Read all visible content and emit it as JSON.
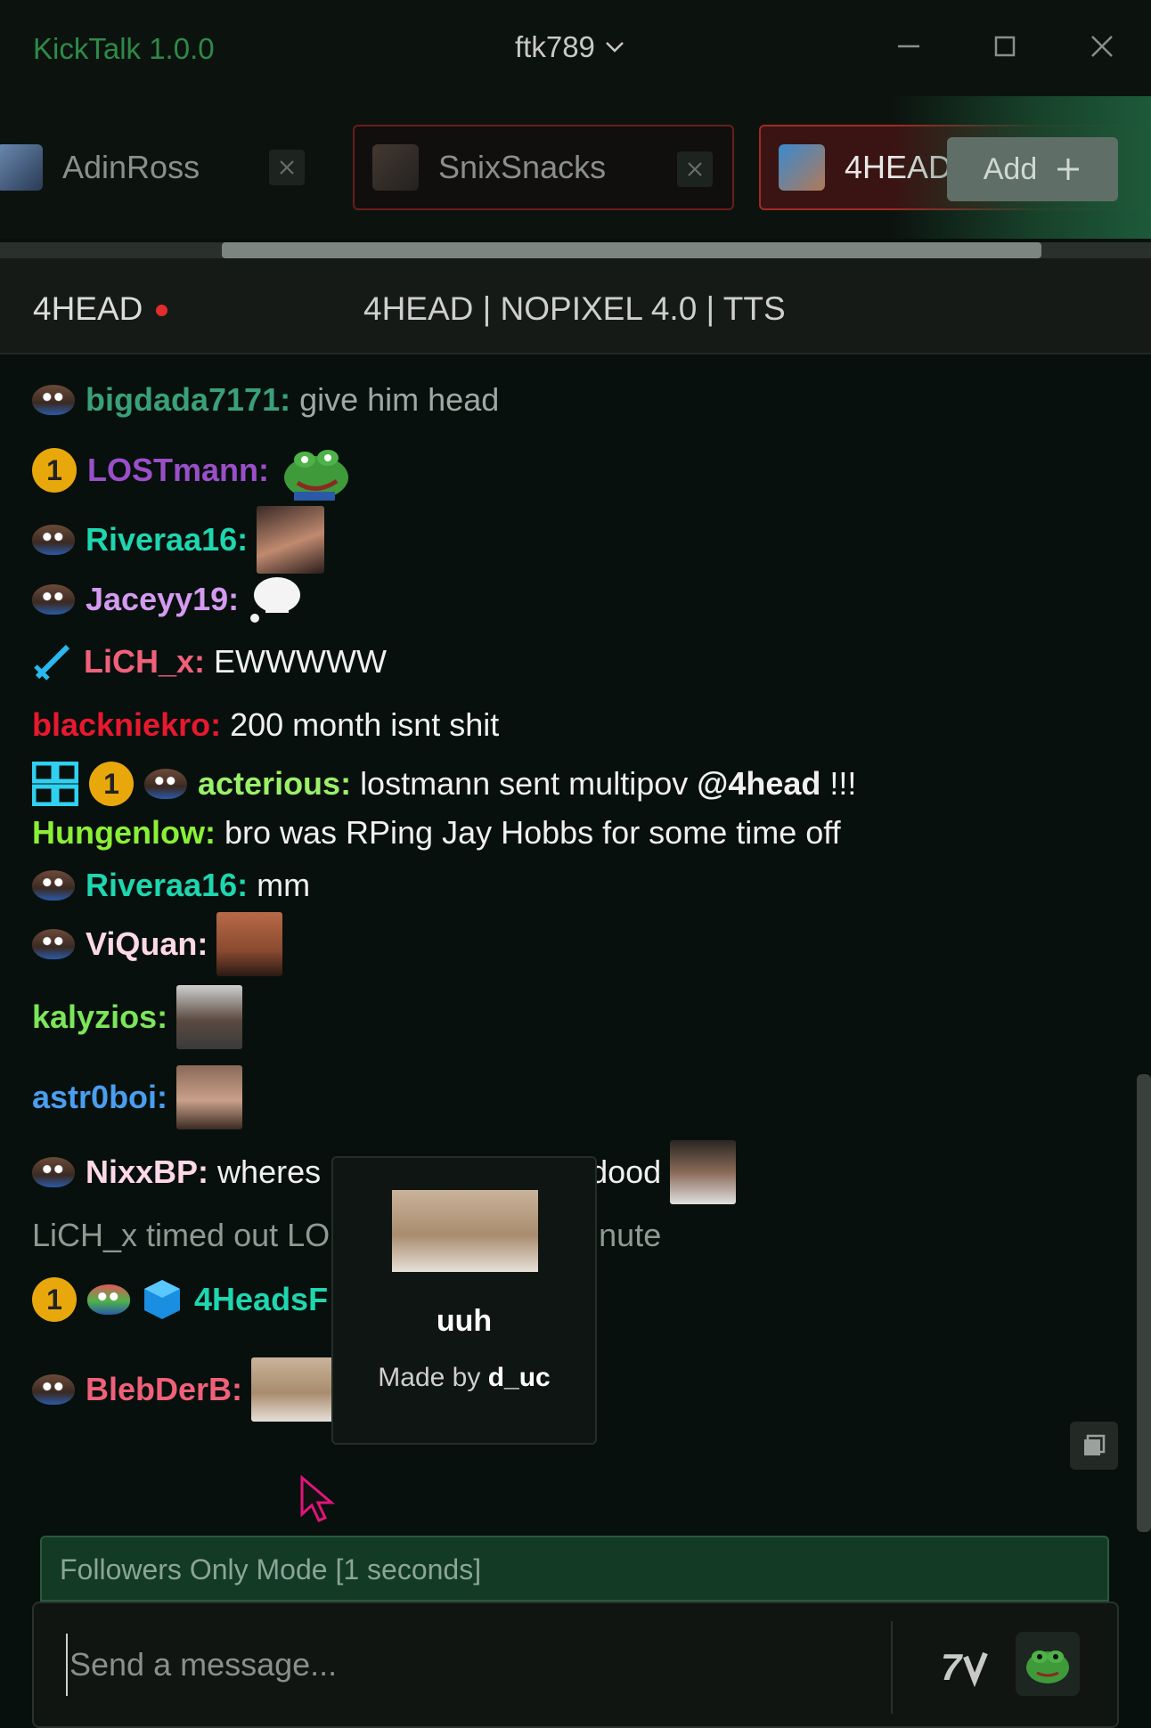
{
  "window": {
    "app_title": "KickTalk 1.0.0",
    "account": "ftk789"
  },
  "tabs": [
    {
      "name": "AdinRoss"
    },
    {
      "name": "SnixSnacks"
    },
    {
      "name": "4HEAD"
    }
  ],
  "add_button_label": "Add",
  "channel": {
    "name": "4HEAD",
    "stream_title": "4HEAD | NOPIXEL 4.0 | TTS"
  },
  "messages": [
    {
      "user": "bigdada7171:",
      "text": "give him head",
      "user_color": "#3aa07a",
      "text_color": "#a0a8a3"
    },
    {
      "user": "LOSTmann:",
      "text": "",
      "user_color": "#9a4fc9"
    },
    {
      "user": "Riveraa16:",
      "text": "",
      "user_color": "#1ed6b0"
    },
    {
      "user": "Jaceyy19:",
      "text": "",
      "user_color": "#d49af0"
    },
    {
      "user": "LiCH_x:",
      "text": "EWWWWW",
      "user_color": "#f0607a"
    },
    {
      "user": "blackniekro:",
      "text": "200 month isnt shit",
      "user_color": "#e8182e"
    },
    {
      "user": "acterious:",
      "text": "lostmann sent multipov",
      "mention": "@4head",
      "suffix": "!!!",
      "user_color": "#9bf06a"
    },
    {
      "user": "Hungenlow:",
      "text": "bro was RPing Jay Hobbs for some time off",
      "user_color": "#8af037"
    },
    {
      "user": "Riveraa16:",
      "text": "mm",
      "user_color": "#1ed6b0"
    },
    {
      "user": "ViQuan:",
      "text": "",
      "user_color": "#ffd8e8"
    },
    {
      "user": "kalyzios:",
      "text": "",
      "user_color": "#7be65a"
    },
    {
      "user": "astr0boi:",
      "text": "",
      "user_color": "#4a9ef0"
    },
    {
      "user": "NixxBP:",
      "text": "wheres",
      "text_after": "dood",
      "user_color": "#ffd8e8"
    },
    {
      "system": "LiCH_x timed out LO",
      "system_after": "nute"
    },
    {
      "user": "4HeadsF",
      "text": "",
      "user_color": "#1ed6b0"
    },
    {
      "user": "BlebDerB:",
      "text": "",
      "user_color": "#f0607a"
    }
  ],
  "sub_badge_label": "1",
  "tooltip": {
    "emote_name": "uuh",
    "made_by_prefix": "Made by",
    "author": "d_uc"
  },
  "followers_banner": "Followers Only Mode [1 seconds]",
  "input": {
    "placeholder": "Send a message..."
  },
  "colors": {
    "accent": "#2e8a47",
    "live": "#e12d2d",
    "active_tab_border": "#a12a24"
  },
  "icons": {
    "account_switch": "chevron-down-icon",
    "minimize": "minimize-icon",
    "maximize": "maximize-icon",
    "close": "close-icon",
    "tab_close": "close-icon",
    "add": "plus-icon",
    "copy": "copy-icon",
    "seventv": "7tv-icon",
    "emote_picker": "pepe-emote-icon"
  }
}
